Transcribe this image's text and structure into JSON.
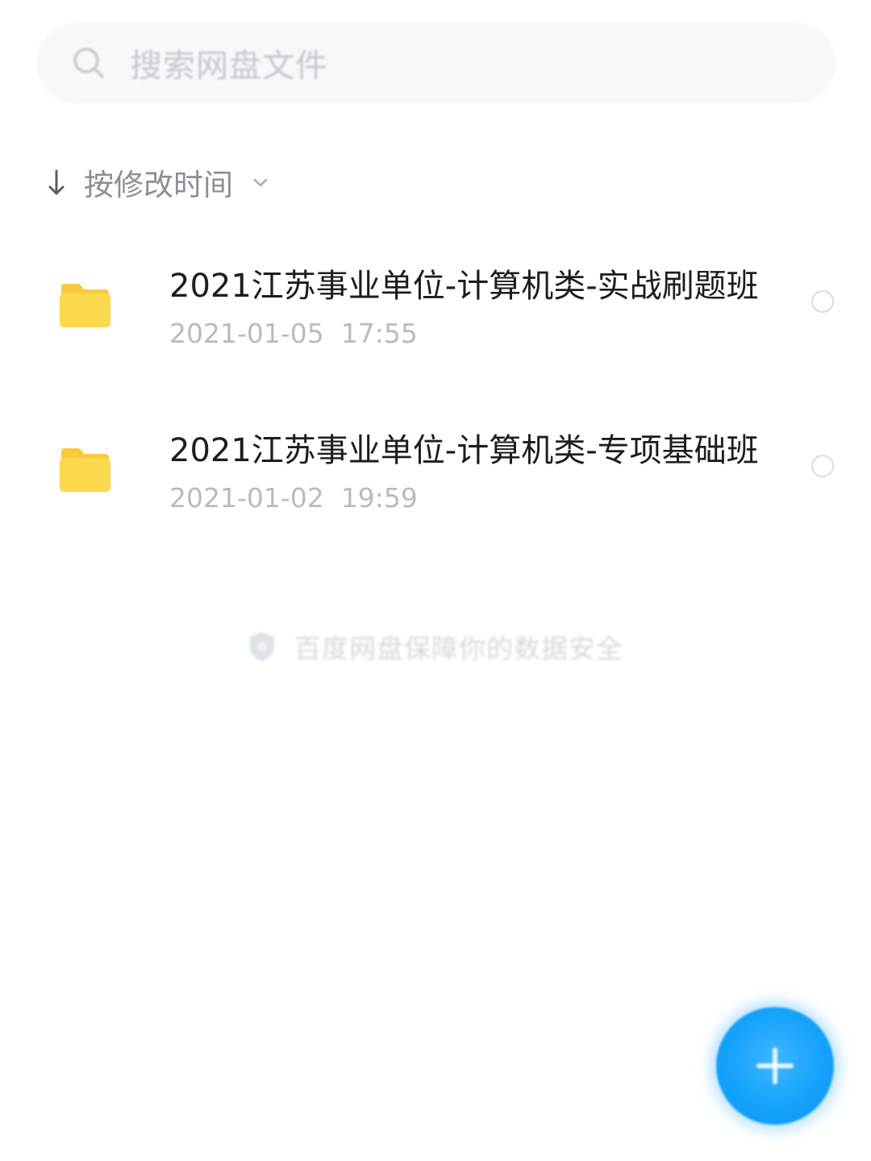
{
  "search": {
    "placeholder": "搜索网盘文件"
  },
  "sort": {
    "label": "按修改时间"
  },
  "files": [
    {
      "name": "2021江苏事业单位-计算机类-实战刷题班",
      "modified": "2021-01-05  17:55"
    },
    {
      "name": "2021江苏事业单位-计算机类-专项基础班",
      "modified": "2021-01-02  19:59"
    }
  ],
  "footer": {
    "safety_text": "百度网盘保障你的数据安全"
  },
  "icons": {
    "search": "search-icon",
    "sort_arrow": "arrow-down-icon",
    "chevron": "chevron-down-icon",
    "folder": "folder-icon",
    "shield": "shield-icon",
    "fab": "plus-icon"
  },
  "colors": {
    "folder": "#ffd94d",
    "fab": "#14a2fb",
    "title_text": "#1b1d22",
    "meta_text": "#b7bbc2"
  }
}
